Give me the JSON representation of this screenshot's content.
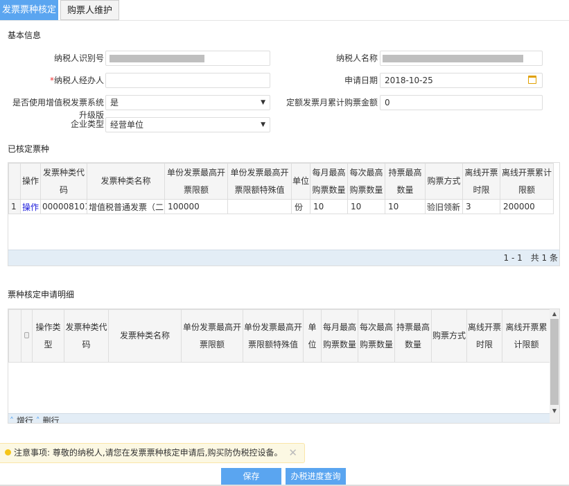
{
  "tabs": [
    "发票票种核定",
    "购票人维护"
  ],
  "basic": {
    "title": "基本信息",
    "taxpayer_id_label": "纳税人识别号",
    "taxpayer_name_label": "纳税人名称",
    "agent_label": "纳税人经办人",
    "required_mark": "*",
    "agent_value": "",
    "apply_date_label": "申请日期",
    "apply_date": "2018-10-25",
    "vat_system_label": "是否使用增值税发票系统",
    "vat_system_value": "是",
    "quota_label": "定额发票月累计购票金额",
    "quota_value": "0",
    "upgrade_label": "升级版",
    "enterprise_type_label": "企业类型",
    "enterprise_type_value": "经营单位"
  },
  "approved": {
    "title": "已核定票种",
    "headers": [
      "操作",
      "发票种类代码",
      "发票种类名称",
      "单份发票最高开票限额",
      "单份发票最高开票限额特殊值",
      "单位",
      "每月最高购票数量",
      "每次最高购票数量",
      "持票最高数量",
      "购票方式",
      "离线开票时限",
      "离线开票累计限额"
    ],
    "rows": [
      [
        "1",
        "操作",
        "000008101",
        "增值税普通发票（二",
        "100000",
        "",
        "份",
        "10",
        "10",
        "10",
        "验旧领新",
        "3",
        "200000"
      ]
    ],
    "pager": "1 - 1　共 1 条"
  },
  "apply": {
    "title": "票种核定申请明细",
    "headers": [
      "操作类型",
      "发票种类代码",
      "发票种类名称",
      "单份发票最高开票限额",
      "单份发票最高开票限额特殊值",
      "单位",
      "每月最高购票数量",
      "每次最高购票数量",
      "持票最高数量",
      "购票方式",
      "离线开票时限",
      "离线开票累计限额"
    ],
    "add_row": "增行",
    "del_row": "删行"
  },
  "notice": "注意事项: 尊敬的纳税人,请您在发票票种核定申请后,购买防伪税控设备。",
  "buttons": {
    "save": "保存",
    "progress": "办税进度查询"
  }
}
